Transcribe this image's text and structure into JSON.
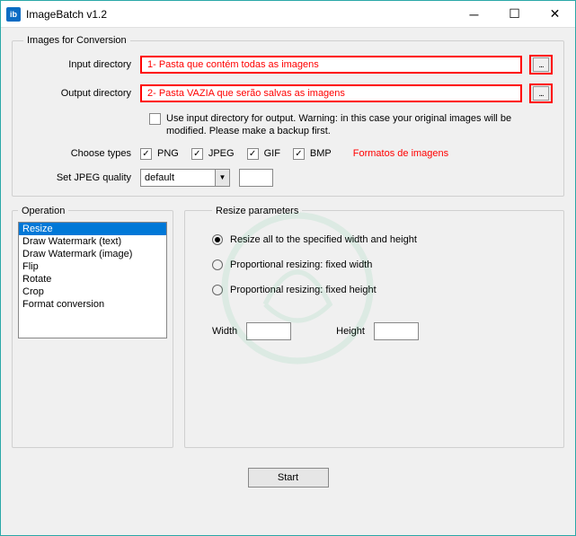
{
  "titlebar": {
    "app_icon_text": "ib",
    "title": "ImageBatch v1.2"
  },
  "groupbox": {
    "conversion_title": "Images for Conversion",
    "input_label": "Input directory",
    "input_hint": "1- Pasta que contém todas as imagens",
    "output_label": "Output directory",
    "output_hint": "2- Pasta VAZIA que serão salvas as imagens",
    "browse_label": "...",
    "use_input_warning": "Use input directory for output. Warning: in this case your original images will be modified. Please make a backup first.",
    "types_label": "Choose types",
    "types": {
      "png": "PNG",
      "jpeg": "JPEG",
      "gif": "GIF",
      "bmp": "BMP"
    },
    "types_annot": "Formatos de imagens",
    "quality_label": "Set JPEG quality",
    "quality_value": "default"
  },
  "operation": {
    "title": "Operation",
    "items": [
      "Resize",
      "Draw Watermark (text)",
      "Draw Watermark (image)",
      "Flip",
      "Rotate",
      "Crop",
      "Format conversion"
    ],
    "selected_index": 0
  },
  "resize": {
    "title": "Resize parameters",
    "opt_all": "Resize all to the specified width and height",
    "opt_width": "Proportional resizing: fixed width",
    "opt_height": "Proportional resizing: fixed height",
    "width_label": "Width",
    "height_label": "Height"
  },
  "start_label": "Start"
}
